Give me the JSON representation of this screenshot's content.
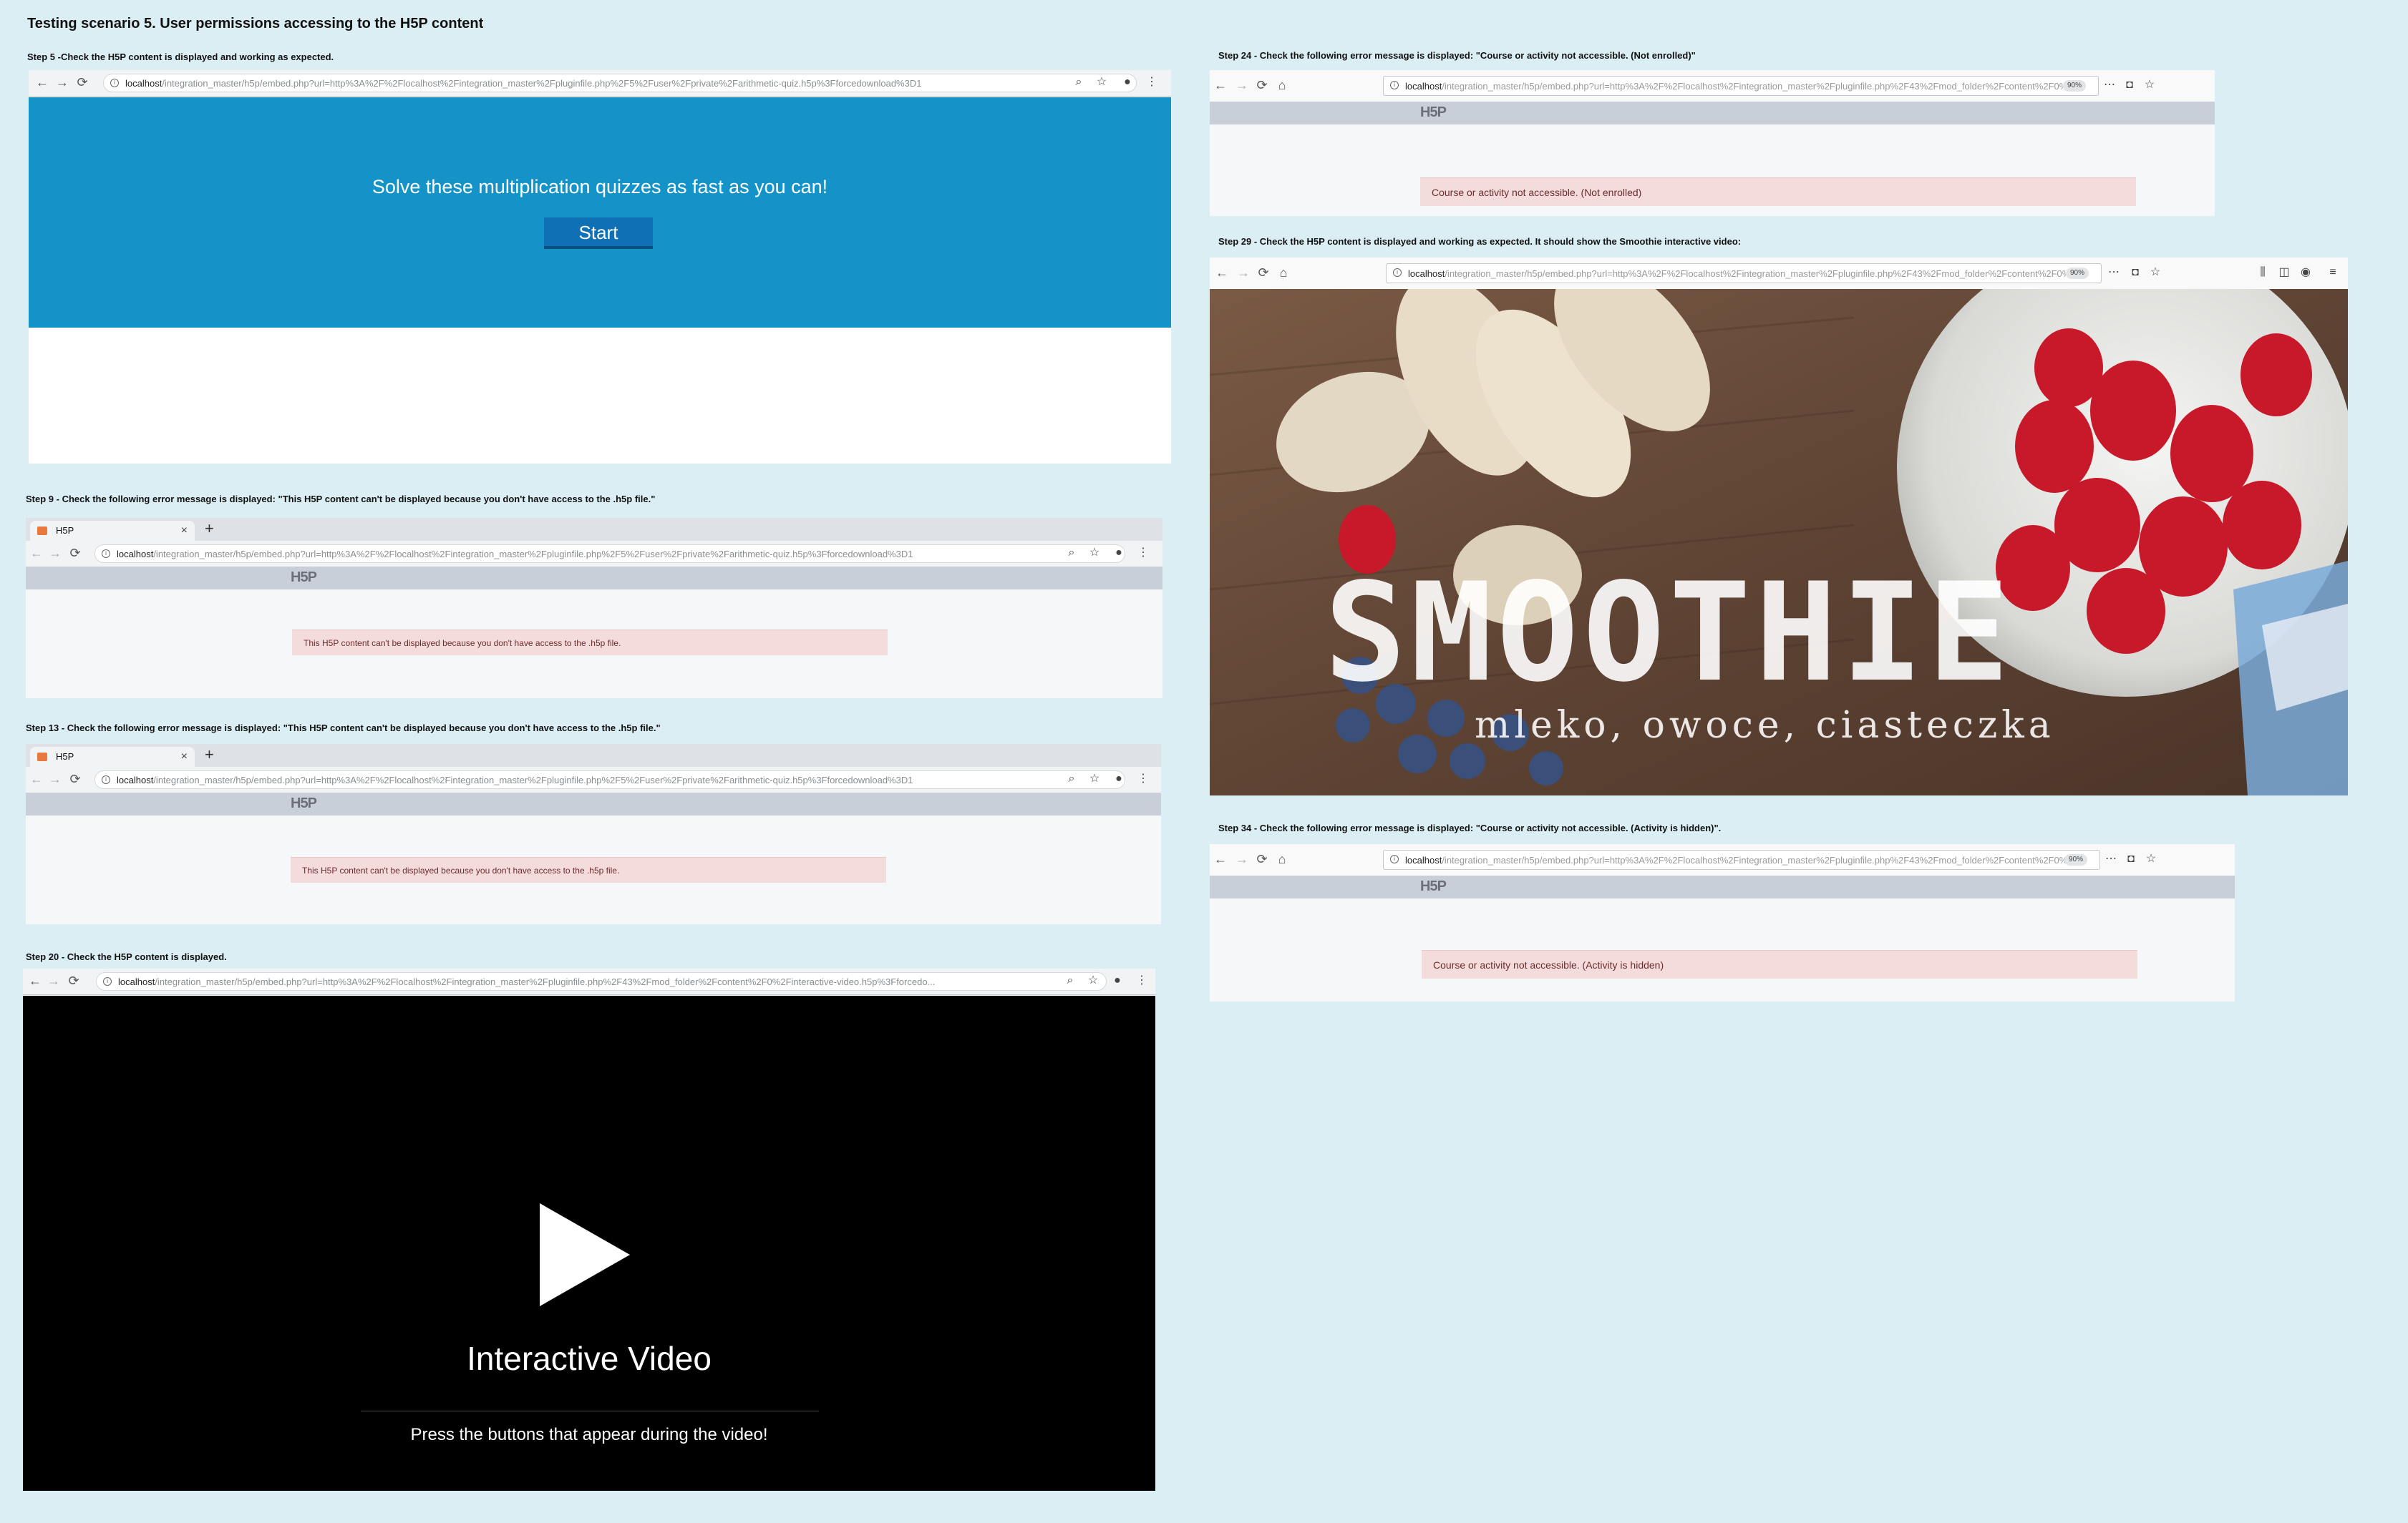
{
  "page": {
    "title": "Testing scenario 5. User permissions accessing to the H5P content"
  },
  "steps": {
    "step5": {
      "caption": "Step 5 -Check the H5P content is displayed and working as expected.",
      "url_host": "localhost",
      "url_path": "/integration_master/h5p/embed.php?url=http%3A%2F%2Flocalhost%2Fintegration_master%2Fpluginfile.php%2F5%2Fuser%2Fprivate%2Farithmetic-quiz.h5p%3Fforcedownload%3D1",
      "quiz_text": "Solve these multiplication quizzes as fast as you can!",
      "start_label": "Start"
    },
    "step9": {
      "caption": "Step 9 - Check the following error message is displayed: \"This H5P content can't be displayed because you don't have access to the .h5p file.\"",
      "tab_title": "H5P",
      "url_host": "localhost",
      "url_path": "/integration_master/h5p/embed.php?url=http%3A%2F%2Flocalhost%2Fintegration_master%2Fpluginfile.php%2F5%2Fuser%2Fprivate%2Farithmetic-quiz.h5p%3Fforcedownload%3D1",
      "logo": "H5P",
      "error": "This H5P content can't be displayed because you don't have access to the .h5p file."
    },
    "step13": {
      "caption": "Step 13 - Check the following error message is displayed: \"This H5P content can't be displayed because you don't have access to the .h5p file.\"",
      "tab_title": "H5P",
      "url_host": "localhost",
      "url_path": "/integration_master/h5p/embed.php?url=http%3A%2F%2Flocalhost%2Fintegration_master%2Fpluginfile.php%2F5%2Fuser%2Fprivate%2Farithmetic-quiz.h5p%3Fforcedownload%3D1",
      "logo": "H5P",
      "error": "This H5P content can't be displayed because you don't have access to the .h5p file."
    },
    "step20": {
      "caption": "Step 20 - Check the H5P content is displayed.",
      "url_host": "localhost",
      "url_path": "/integration_master/h5p/embed.php?url=http%3A%2F%2Flocalhost%2Fintegration_master%2Fpluginfile.php%2F43%2Fmod_folder%2Fcontent%2F0%2Finteractive-video.h5p%3Fforcedo...",
      "video_title": "Interactive Video",
      "video_subtitle": "Press the buttons that appear during the video!"
    },
    "step24": {
      "caption": "Step 24 - Check the following error message is displayed: \"Course or activity not accessible. (Not enrolled)\"",
      "url_host": "localhost",
      "url_path": "/integration_master/h5p/embed.php?url=http%3A%2F%2Flocalhost%2Fintegration_master%2Fpluginfile.php%2F43%2Fmod_folder%2Fcontent%2F0%...",
      "zoom": "90%",
      "logo": "H5P",
      "error": "Course or activity not accessible. (Not enrolled)"
    },
    "step29": {
      "caption": "Step 29 - Check the H5P content is displayed and working as expected. It should show the Smoothie interactive video:",
      "url_host": "localhost",
      "url_path": "/integration_master/h5p/embed.php?url=http%3A%2F%2Flocalhost%2Fintegration_master%2Fpluginfile.php%2F43%2Fmod_folder%2Fcontent%2F0%...",
      "zoom": "90%",
      "video_word": "SMOOTHIE",
      "video_sub": "mleko, owoce, ciasteczka"
    },
    "step34": {
      "caption": "Step 34 - Check the following error message is displayed: \"Course or activity not accessible. (Activity is hidden)\".",
      "url_host": "localhost",
      "url_path": "/integration_master/h5p/embed.php?url=http%3A%2F%2Flocalhost%2Fintegration_master%2Fpluginfile.php%2F43%2Fmod_folder%2Fcontent%2F0%...",
      "zoom": "90%",
      "logo": "H5P",
      "error": "Course or activity not accessible. (Activity is hidden)"
    }
  },
  "icons": {
    "back": "back-arrow-icon",
    "forward": "forward-arrow-icon",
    "reload": "reload-icon",
    "home": "home-icon",
    "info": "info-icon",
    "search": "search-icon",
    "star": "star-icon",
    "account": "account-icon",
    "menu": "menu-dots-icon",
    "pocket": "pocket-icon",
    "play": "play-icon"
  },
  "colors": {
    "background": "#dbeef4",
    "quiz_blue": "#1493c9",
    "start_button": "#0f70b5",
    "error_bg": "#f5dcdc"
  }
}
